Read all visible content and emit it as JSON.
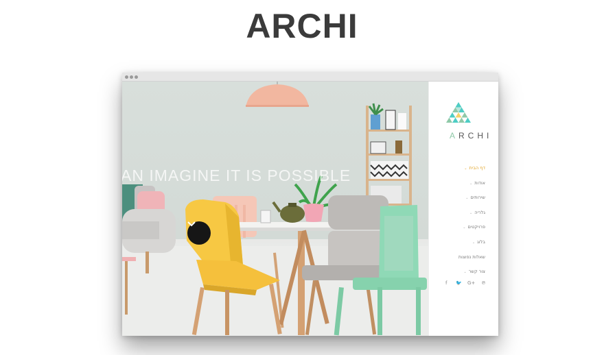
{
  "page": {
    "title": "ARCHI"
  },
  "hero": {
    "tagline": "AN IMAGINE IT IS POSSIBLE",
    "scroll_icon": "chevron-down-icon"
  },
  "sidebar": {
    "logo_icon": "triangle-mosaic-logo",
    "brand_accent": "A",
    "brand_rest": "RCHI",
    "nav": [
      {
        "label": "דף הבית",
        "active": true
      },
      {
        "label": "אודות",
        "active": false
      },
      {
        "label": "שירותים",
        "active": false
      },
      {
        "label": "גלריה",
        "active": false
      },
      {
        "label": "פרויקטים",
        "active": false
      },
      {
        "label": "בלוג",
        "active": false
      },
      {
        "label": "שאלות נפוצות",
        "active": false
      },
      {
        "label": "צור קשר",
        "active": false
      }
    ],
    "social": {
      "facebook": "f",
      "twitter": "🐦",
      "google": "G+",
      "pinterest": "℗"
    }
  },
  "colors": {
    "accent": "#e2a323",
    "logo_teal": "#4ecdc4",
    "logo_green": "#8fc9a8"
  }
}
